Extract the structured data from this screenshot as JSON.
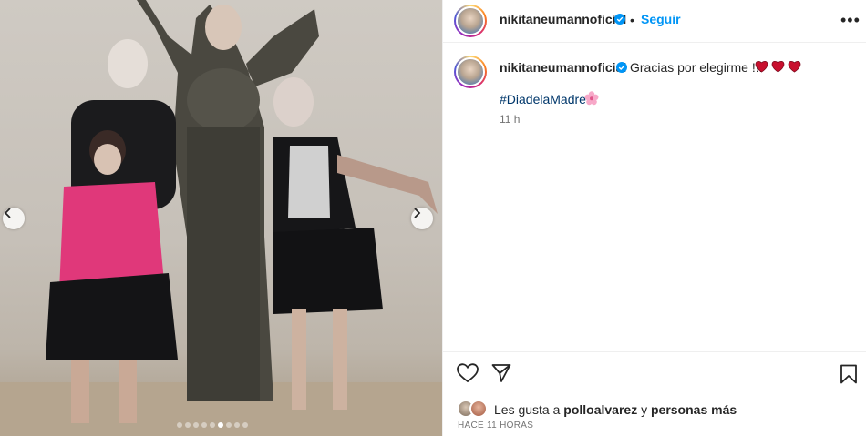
{
  "post": {
    "username": "nikitaneumannoficial",
    "follow_label": "Seguir",
    "separator": "•",
    "more_label": "•••"
  },
  "caption": {
    "username": "nikitaneumannoficial",
    "text": "Gracias por elegirme !!!",
    "hashtag": "#DiadelaMadre",
    "time": "11 h"
  },
  "likes": {
    "prefix": "Les gusta a ",
    "user": "polloalvarez",
    "connector": " y ",
    "others": "personas más"
  },
  "posted_ago": "HACE 11 HORAS",
  "carousel": {
    "total": 9,
    "active_index": 5
  },
  "colors": {
    "follow": "#0095f6",
    "hashtag": "#00376b",
    "heart": "#ed4956",
    "verified": "#0095f6"
  }
}
